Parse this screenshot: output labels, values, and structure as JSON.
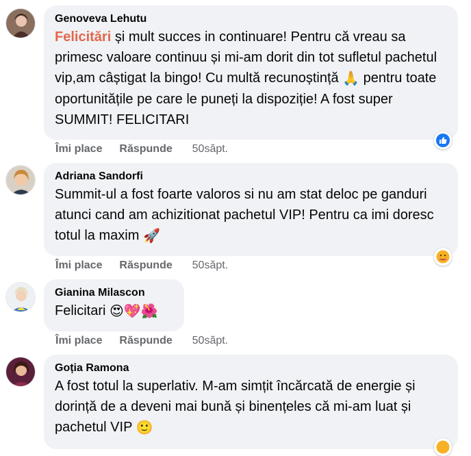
{
  "comments": [
    {
      "author": "Genoveva Lehutu",
      "highlight": "Felicitări",
      "text_1": " și mult succes in continuare! Pentru că vreau sa primesc valoare continuu și mi-am dorit din tot sufletul pachetul vip,am câștigat la bingo! Cu multă recunoștință ",
      "emoji_1": "🙏",
      "text_2": "  pentru toate oportunitățile pe care le puneți la dispoziție! A fost super SUMMIT! FELICITARI",
      "like": "Îmi place",
      "reply": "Răspunde",
      "time": "50săpt.",
      "reaction_icon": "like-icon"
    },
    {
      "author": "Adriana Sandorfi",
      "text_1": "Summit-ul a fost foarte valoros si nu am stat deloc pe ganduri atunci cand am achizitionat pachetul VIP! Pentru ca imi doresc totul la maxim ",
      "emoji_1": "🚀",
      "like": "Îmi place",
      "reply": "Răspunde",
      "time": "50săpt.",
      "reaction_icon": "care-icon"
    },
    {
      "author": "Gianina Milascon",
      "text_1": "Felicitari ",
      "emoji_1": "😍💖🌺",
      "like": "Îmi place",
      "reply": "Răspunde",
      "time": "50săpt."
    },
    {
      "author": "Goția Ramona",
      "text_1": "A fost totul la superlativ. M-am simțit încărcată de energie și dorință de a deveni mai bună și binențeles că mi-am luat și pachetul VIP ",
      "emoji_1": "🙂"
    }
  ],
  "colors": {
    "bubble": "#f0f2f5",
    "highlight": "#e4664b",
    "meta": "#65676b",
    "like_blue": "#1877f2"
  }
}
